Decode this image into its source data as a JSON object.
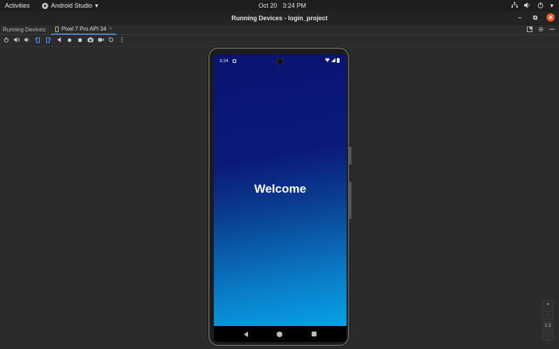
{
  "topbar": {
    "activities": "Activities",
    "app_name": "Android Studio",
    "app_menu_arrow": "▾",
    "date": "Oct 20",
    "time": "3:24 PM",
    "tray_icons": [
      "network-icon",
      "volume-icon",
      "power-icon"
    ],
    "tray_menu_arrow": "▾"
  },
  "window": {
    "title": "Running Devices - login_project",
    "minimize": "–",
    "restore": "⧉",
    "close": "✕"
  },
  "tabs": {
    "section_label": "Running Devices:",
    "device_tab": "Pixel 7 Pro API 34",
    "tab_close": "×"
  },
  "toolbar": {
    "icons": [
      "power-icon",
      "volume-up-icon",
      "volume-down-icon",
      "rotate-left-icon",
      "rotate-right-icon",
      "back-icon",
      "home-icon",
      "overview-icon",
      "screenshot-icon",
      "screen-record-icon",
      "reset-icon",
      "more-icon"
    ]
  },
  "device": {
    "status_time": "3:24",
    "app_welcome": "Welcome",
    "gradient_top": "#0a1470",
    "gradient_bottom": "#06a2e4"
  },
  "zoom": {
    "zoom_in": "+",
    "zoom_out": "−",
    "actual_size": "1:1",
    "fit": "⬚"
  }
}
